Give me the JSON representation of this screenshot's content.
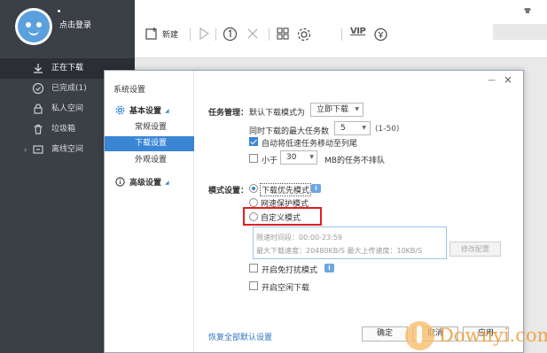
{
  "sidebar": {
    "login_label": "点击登录",
    "items": [
      {
        "label": "正在下载",
        "icon": "download-icon",
        "active": true
      },
      {
        "label": "已完成(1)",
        "icon": "check-circle-icon",
        "active": false
      },
      {
        "label": "私人空间",
        "icon": "lock-icon",
        "active": false
      },
      {
        "label": "垃圾箱",
        "icon": "trash-icon",
        "active": false
      },
      {
        "label": "离线空间",
        "icon": "offline-space-icon",
        "active": false
      }
    ]
  },
  "toolbar": {
    "new_label": "新建",
    "vip_label": "VIP"
  },
  "dialog": {
    "title": "系统设置",
    "min_glyph": "—",
    "close_glyph": "×",
    "categories": {
      "basic": "基本设置",
      "advanced": "高级设置"
    },
    "subitems": [
      "常规设置",
      "下载设置",
      "外观设置"
    ],
    "active_subitem": "下载设置",
    "task": {
      "section_label": "任务管理：",
      "default_mode_label": "默认下载模式为",
      "default_mode_value": "立即下载",
      "max_tasks_label": "同时下载的最大任务数",
      "max_tasks_value": "5",
      "max_tasks_range": "(1-50)",
      "auto_move_label": "自动将低速任务移动至列尾",
      "auto_move_checked": true,
      "less_than_label": "小于",
      "less_than_value": "30",
      "less_than_suffix": "MB的任务不排队",
      "less_than_checked": false
    },
    "mode": {
      "section_label": "模式设置：",
      "options": [
        "下载优先模式",
        "网速保护模式",
        "自定义模式"
      ],
      "selected": "下载优先模式",
      "custom_time": "限速时间段：00:00-23:59",
      "custom_speed": "最大下载速度：20480KB/S  最大上传速度：10KB/S",
      "modify_button": "修改配置"
    },
    "extra": {
      "no_disturb_label": "开启免打扰模式",
      "no_disturb_checked": false,
      "idle_download_label": "开启空闲下载",
      "idle_download_checked": false
    },
    "reset_link": "恢复全部默认设置",
    "ok_button": "确定",
    "cancel_button": "取消",
    "apply_button": "应用"
  },
  "watermark": {
    "text": "Downyi.com"
  },
  "colors": {
    "sidebar_bg": "#3b3f46",
    "accent": "#3a86d5",
    "highlight": "#e02020"
  }
}
